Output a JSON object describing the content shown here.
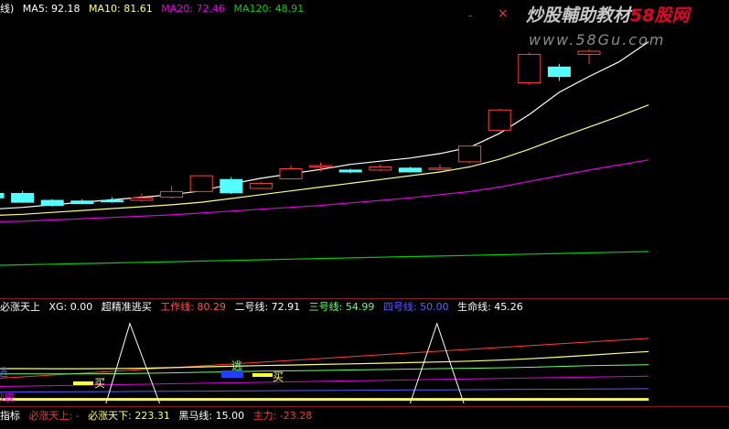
{
  "main_legend": {
    "prefix": "线)",
    "ma5": "MA5: 92.18",
    "ma10": "MA10: 81.61",
    "ma20": "MA20: 72.46",
    "ma120": "MA120: 48.91"
  },
  "window_controls": {
    "close": "×",
    "minimize": "-"
  },
  "watermark": {
    "line1": "炒股輔助教材",
    "line1_brand": "58股网",
    "line2": "www.58Gu.com",
    "colors": {
      "line1": "#c8c8c8",
      "brand": "#e8002a",
      "line2": "#8a8a8a"
    }
  },
  "sub_legend": {
    "name": "必涨天上",
    "xg": "XG: 0.00",
    "title": "超精准逃买",
    "work": "工作线: 80.29",
    "line2": "二号线: 72.91",
    "line3": "三号线: 54.99",
    "line4": "四号线: 50.00",
    "life": "生命线: 45.26"
  },
  "sub_markers": {
    "sell": "逃",
    "buy1": "买",
    "buy2": "买",
    "left_top": "逃",
    "left_bottom": "抄底"
  },
  "bottom_legend": {
    "prefix": "指标",
    "up": "必涨天上: -",
    "down": "必涨天下: 223.31",
    "black_horse": "黑马线: 15.00",
    "main_force": "主力: -23.28"
  },
  "colors": {
    "up_candle": "#ff3c3c",
    "down_candle": "#54ffff",
    "ma5": "#ffffff",
    "ma10": "#ffff7e",
    "ma20": "#e000e0",
    "ma120": "#00d000",
    "separator": "#8b1a1a",
    "legend_label": "#ffffff"
  },
  "chart_data": [
    {
      "type": "candlestick",
      "series": [
        {
          "name": "MA5",
          "values": [
            79.5,
            79.8,
            80.2,
            80.6,
            81.0,
            81.4,
            81.8,
            82.4,
            83.5,
            84.4,
            85.1,
            85.8,
            86.6,
            87.1,
            87.6,
            88.3,
            89.3,
            91.5,
            94.5,
            98.0,
            100.5,
            102.8,
            106.0
          ]
        },
        {
          "name": "MA10",
          "values": [
            78.5,
            78.7,
            79.0,
            79.3,
            79.6,
            79.9,
            80.2,
            80.6,
            81.2,
            81.8,
            82.4,
            83.0,
            83.6,
            84.2,
            84.8,
            85.4,
            86.2,
            87.4,
            89.0,
            90.8,
            92.5,
            94.2,
            96.0
          ]
        },
        {
          "name": "MA20",
          "values": [
            77.5,
            77.6,
            77.8,
            78.0,
            78.2,
            78.4,
            78.6,
            78.9,
            79.2,
            79.5,
            79.8,
            80.1,
            80.5,
            80.9,
            81.3,
            81.8,
            82.3,
            83.0,
            83.9,
            84.8,
            85.7,
            86.5,
            87.3
          ]
        },
        {
          "name": "MA120",
          "values": [
            70.6,
            70.7,
            70.8,
            70.9,
            71.0,
            71.1,
            71.2,
            71.3,
            71.4,
            71.5,
            71.6,
            71.7,
            71.8,
            71.9,
            72.0,
            72.1,
            72.2,
            72.3,
            72.4,
            72.5,
            72.6,
            72.7,
            72.8
          ]
        }
      ],
      "candles": [
        {
          "o": 82.0,
          "c": 81.3,
          "h": 82.2,
          "l": 81.1
        },
        {
          "o": 82.0,
          "c": 80.6,
          "h": 82.4,
          "l": 80.5
        },
        {
          "o": 80.9,
          "c": 80.1,
          "h": 81.1,
          "l": 79.9
        },
        {
          "o": 80.8,
          "c": 80.4,
          "h": 81.1,
          "l": 80.3
        },
        {
          "o": 80.9,
          "c": 80.7,
          "h": 81.4,
          "l": 80.5
        },
        {
          "o": 80.9,
          "c": 81.3,
          "h": 82.0,
          "l": 80.7
        },
        {
          "o": 81.4,
          "c": 82.3,
          "h": 83.2,
          "l": 81.2
        },
        {
          "o": 82.3,
          "c": 84.8,
          "h": 84.9,
          "l": 82.2
        },
        {
          "o": 84.2,
          "c": 82.1,
          "h": 84.6,
          "l": 81.9
        },
        {
          "o": 82.8,
          "c": 83.6,
          "h": 83.8,
          "l": 82.7
        },
        {
          "o": 84.3,
          "c": 85.9,
          "h": 86.4,
          "l": 84.2
        },
        {
          "o": 86.2,
          "c": 86.4,
          "h": 86.9,
          "l": 85.5
        },
        {
          "o": 85.7,
          "c": 85.4,
          "h": 85.9,
          "l": 85.2
        },
        {
          "o": 85.7,
          "c": 86.2,
          "h": 86.6,
          "l": 85.5
        },
        {
          "o": 86.0,
          "c": 85.4,
          "h": 86.2,
          "l": 85.3
        },
        {
          "o": 85.8,
          "c": 86.0,
          "h": 86.6,
          "l": 85.6
        },
        {
          "o": 87.0,
          "c": 89.5,
          "h": 89.6,
          "l": 86.8
        },
        {
          "o": 92.0,
          "c": 95.2,
          "h": 95.4,
          "l": 91.8
        },
        {
          "o": 99.5,
          "c": 104.0,
          "h": 104.3,
          "l": 99.2
        },
        {
          "o": 102.0,
          "c": 100.5,
          "h": 102.5,
          "l": 99.8
        },
        {
          "o": 104.0,
          "c": 104.5,
          "h": 104.8,
          "l": 102.5
        }
      ],
      "ylim": [
        66,
        110
      ]
    },
    {
      "type": "line",
      "series": [
        {
          "name": "工作线",
          "values": [
            31.0,
            33.2,
            35.5,
            37.8,
            40.1,
            42.4,
            44.7,
            47.0,
            49.3,
            51.6,
            53.9,
            56.2,
            58.5,
            60.8,
            63.1,
            65.4,
            67.7,
            70.0,
            72.3,
            74.6,
            76.9,
            79.2,
            81.5
          ]
        },
        {
          "name": "二号线",
          "values": [
            43.5,
            43.5,
            43.4,
            43.4,
            43.5,
            44.0,
            44.8,
            45.7,
            46.5,
            47.3,
            48.0,
            48.8,
            49.5,
            50.3,
            51.1,
            51.9,
            52.9,
            54.2,
            55.9,
            58.0,
            60.3,
            62.8,
            65.0
          ]
        },
        {
          "name": "三号线",
          "values": [
            37.0,
            37.0,
            37.0,
            37.0,
            37.2,
            37.7,
            38.3,
            39.0,
            39.6,
            40.3,
            40.8,
            41.3,
            41.8,
            42.4,
            43.0,
            43.5,
            44.0,
            44.6,
            45.3,
            46.3,
            47.2,
            47.9,
            48.5
          ]
        },
        {
          "name": "四号线",
          "values": [
            21.0,
            21.6,
            22.2,
            22.8,
            23.4,
            24.0,
            24.6,
            25.2,
            25.8,
            26.4,
            27.0,
            27.6,
            28.2,
            28.8,
            29.4,
            30.0,
            30.6,
            31.2,
            31.8,
            32.4,
            33.0,
            33.6,
            34.2
          ]
        },
        {
          "name": "生命线",
          "values": [
            14.0,
            14.2,
            14.4,
            14.6,
            14.8,
            15.0,
            15.2,
            15.4,
            15.6,
            15.8,
            16.0,
            16.2,
            16.4,
            16.6,
            16.8,
            17.0,
            17.2,
            17.4,
            17.6,
            17.8,
            18.0,
            18.2,
            18.4
          ]
        },
        {
          "name": "必涨天下",
          "values": [
            5.0,
            5.0,
            5.0,
            5.0,
            5.0,
            5.0,
            5.0,
            5.0,
            5.0,
            5.0,
            5.0,
            5.0,
            5.0,
            5.0,
            5.0,
            5.0,
            5.0,
            5.0,
            5.0,
            5.0,
            5.0,
            5.0,
            5.0
          ]
        }
      ],
      "peaks": [
        {
          "from": 3.8,
          "peak": 4.6,
          "to": 5.6,
          "peak_value": 100
        },
        {
          "from": 14.0,
          "peak": 14.9,
          "to": 15.8,
          "peak_value": 100
        }
      ],
      "ylim": [
        0,
        110
      ]
    }
  ]
}
